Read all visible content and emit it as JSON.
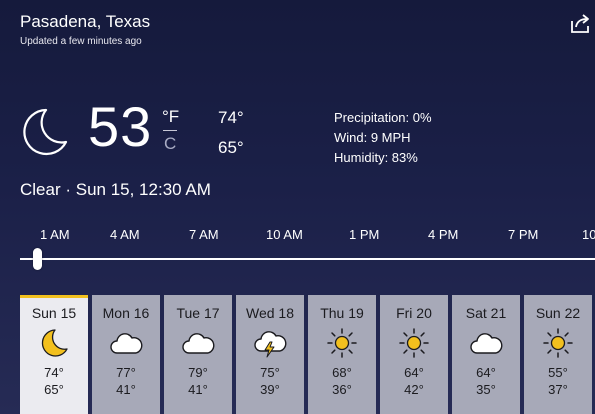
{
  "location": "Pasadena, Texas",
  "updated": "Updated a few minutes ago",
  "current": {
    "icon": "moon-icon",
    "temp": "53",
    "unit_f": "°F",
    "unit_c": "C",
    "high": "74°",
    "low": "65°",
    "precipitation": "Precipitation: 0%",
    "wind": "Wind: 9 MPH",
    "humidity": "Humidity: 83%",
    "condition": "Clear · Sun 15, 12:30 AM"
  },
  "hours": [
    "1 AM",
    "4 AM",
    "7 AM",
    "10 AM",
    "1 PM",
    "4 PM",
    "7 PM",
    "10"
  ],
  "days": [
    {
      "name": "Sun 15",
      "hi": "74°",
      "lo": "65°",
      "icon": "moon-icon"
    },
    {
      "name": "Mon 16",
      "hi": "77°",
      "lo": "41°",
      "icon": "cloud-icon"
    },
    {
      "name": "Tue 17",
      "hi": "79°",
      "lo": "41°",
      "icon": "cloud-icon"
    },
    {
      "name": "Wed 18",
      "hi": "75°",
      "lo": "39°",
      "icon": "thunder-cloud-icon"
    },
    {
      "name": "Thu 19",
      "hi": "68°",
      "lo": "36°",
      "icon": "sun-icon"
    },
    {
      "name": "Fri 20",
      "hi": "64°",
      "lo": "42°",
      "icon": "sun-icon"
    },
    {
      "name": "Sat 21",
      "hi": "64°",
      "lo": "35°",
      "icon": "cloud-icon"
    },
    {
      "name": "Sun 22",
      "hi": "55°",
      "lo": "37°",
      "icon": "sun-icon"
    }
  ],
  "colors": {
    "active_accent": "#f2c01e",
    "sun": "#f2c01e",
    "bg_top": "#151a3c",
    "bg_bottom": "#262b55"
  }
}
